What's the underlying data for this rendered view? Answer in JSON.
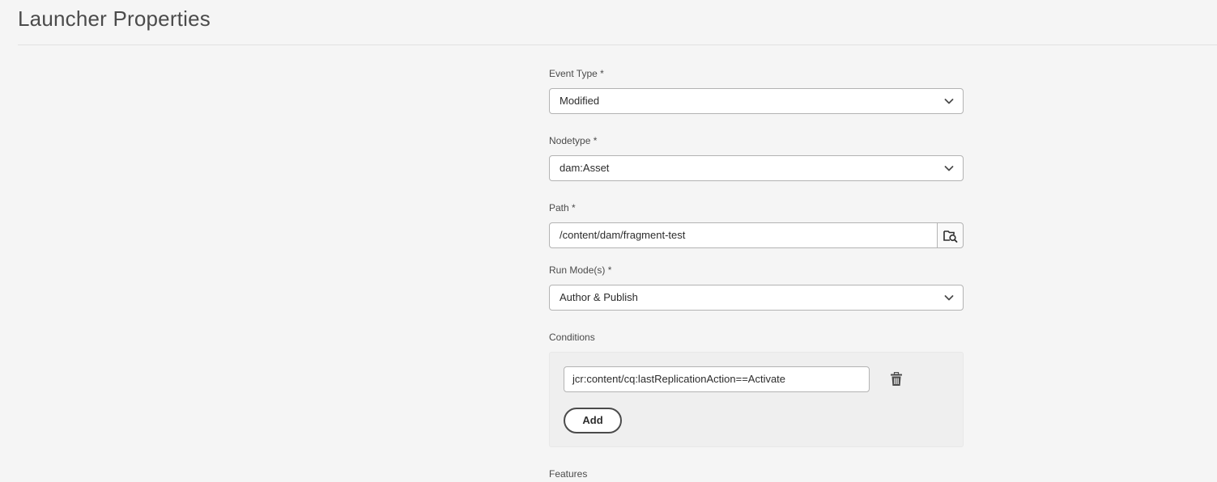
{
  "page": {
    "title": "Launcher Properties"
  },
  "form": {
    "event_type": {
      "label": "Event Type *",
      "value": "Modified"
    },
    "nodetype": {
      "label": "Nodetype *",
      "value": "dam:Asset"
    },
    "path": {
      "label": "Path *",
      "value": "/content/dam/fragment-test"
    },
    "run_modes": {
      "label": "Run Mode(s) *",
      "value": "Author & Publish"
    },
    "conditions": {
      "label": "Conditions",
      "items": [
        {
          "value": "jcr:content/cq:lastReplicationAction==Activate"
        }
      ],
      "add_label": "Add"
    },
    "features": {
      "label": "Features"
    }
  },
  "icons": {
    "dropdown": "chevron-down-icon",
    "browse": "folder-search-icon",
    "delete": "trash-icon"
  }
}
